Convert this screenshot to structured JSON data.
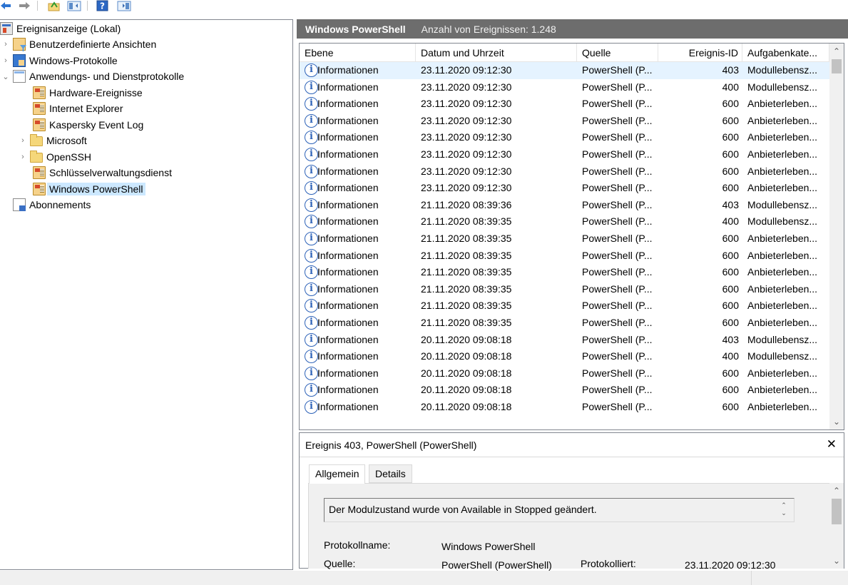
{
  "toolbar": {
    "buttons": [
      "back-icon",
      "forward-icon",
      "up-folder-icon",
      "show-hide-console-tree-icon",
      "help-icon",
      "show-hide-action-pane-icon"
    ]
  },
  "tree": {
    "items": [
      {
        "label": "Ereignisanzeige (Lokal)",
        "icon": "event-viewer-icon",
        "expanded": true
      },
      {
        "label": "Benutzerdefinierte Ansichten",
        "icon": "custom-views-icon"
      },
      {
        "label": "Windows-Protokolle",
        "icon": "windows-logs-icon"
      },
      {
        "label": "Anwendungs- und Dienstprotokolle",
        "icon": "app-service-logs-icon",
        "expanded": true
      },
      {
        "label": "Hardware-Ereignisse",
        "icon": "log-icon"
      },
      {
        "label": "Internet Explorer",
        "icon": "log-icon"
      },
      {
        "label": "Kaspersky Event Log",
        "icon": "log-icon"
      },
      {
        "label": "Microsoft",
        "icon": "folder-icon"
      },
      {
        "label": "OpenSSH",
        "icon": "folder-icon"
      },
      {
        "label": "Schlüsselverwaltungsdienst",
        "icon": "log-icon"
      },
      {
        "label": "Windows PowerShell",
        "icon": "log-icon",
        "selected": true
      },
      {
        "label": "Abonnements",
        "icon": "subscriptions-icon"
      }
    ]
  },
  "log": {
    "name": "Windows PowerShell",
    "count_text": "Anzahl von Ereignissen: 1.248"
  },
  "grid": {
    "columns": [
      "Ebene",
      "Datum und Uhrzeit",
      "Quelle",
      "Ereignis-ID",
      "Aufgabenkate..."
    ],
    "rows": [
      [
        "Informationen",
        "23.11.2020 09:12:30",
        "PowerShell (P...",
        "403",
        "Modullebensz..."
      ],
      [
        "Informationen",
        "23.11.2020 09:12:30",
        "PowerShell (P...",
        "400",
        "Modullebensz..."
      ],
      [
        "Informationen",
        "23.11.2020 09:12:30",
        "PowerShell (P...",
        "600",
        "Anbieterleben..."
      ],
      [
        "Informationen",
        "23.11.2020 09:12:30",
        "PowerShell (P...",
        "600",
        "Anbieterleben..."
      ],
      [
        "Informationen",
        "23.11.2020 09:12:30",
        "PowerShell (P...",
        "600",
        "Anbieterleben..."
      ],
      [
        "Informationen",
        "23.11.2020 09:12:30",
        "PowerShell (P...",
        "600",
        "Anbieterleben..."
      ],
      [
        "Informationen",
        "23.11.2020 09:12:30",
        "PowerShell (P...",
        "600",
        "Anbieterleben..."
      ],
      [
        "Informationen",
        "23.11.2020 09:12:30",
        "PowerShell (P...",
        "600",
        "Anbieterleben..."
      ],
      [
        "Informationen",
        "21.11.2020 08:39:36",
        "PowerShell (P...",
        "403",
        "Modullebensz..."
      ],
      [
        "Informationen",
        "21.11.2020 08:39:35",
        "PowerShell (P...",
        "400",
        "Modullebensz..."
      ],
      [
        "Informationen",
        "21.11.2020 08:39:35",
        "PowerShell (P...",
        "600",
        "Anbieterleben..."
      ],
      [
        "Informationen",
        "21.11.2020 08:39:35",
        "PowerShell (P...",
        "600",
        "Anbieterleben..."
      ],
      [
        "Informationen",
        "21.11.2020 08:39:35",
        "PowerShell (P...",
        "600",
        "Anbieterleben..."
      ],
      [
        "Informationen",
        "21.11.2020 08:39:35",
        "PowerShell (P...",
        "600",
        "Anbieterleben..."
      ],
      [
        "Informationen",
        "21.11.2020 08:39:35",
        "PowerShell (P...",
        "600",
        "Anbieterleben..."
      ],
      [
        "Informationen",
        "21.11.2020 08:39:35",
        "PowerShell (P...",
        "600",
        "Anbieterleben..."
      ],
      [
        "Informationen",
        "20.11.2020 09:08:18",
        "PowerShell (P...",
        "403",
        "Modullebensz..."
      ],
      [
        "Informationen",
        "20.11.2020 09:08:18",
        "PowerShell (P...",
        "400",
        "Modullebensz..."
      ],
      [
        "Informationen",
        "20.11.2020 09:08:18",
        "PowerShell (P...",
        "600",
        "Anbieterleben..."
      ],
      [
        "Informationen",
        "20.11.2020 09:08:18",
        "PowerShell (P...",
        "600",
        "Anbieterleben..."
      ],
      [
        "Informationen",
        "20.11.2020 09:08:18",
        "PowerShell (P...",
        "600",
        "Anbieterleben..."
      ]
    ]
  },
  "details": {
    "title": "Ereignis 403, PowerShell (PowerShell)",
    "tabs": [
      "Allgemein",
      "Details"
    ],
    "description": "Der Modulzustand wurde von Available in Stopped geändert.",
    "fields": {
      "log_name_label": "Protokollname:",
      "log_name_value": "Windows PowerShell",
      "source_label": "Quelle:",
      "source_value": "PowerShell (PowerShell)",
      "logged_label": "Protokolliert:",
      "logged_value": "23.11.2020 09:12:30"
    }
  },
  "colors": {
    "header_bg": "#6d6d6d",
    "selected_row": "#e5f3ff",
    "selected_tree": "#cce8ff",
    "info_icon": "#2d62b8"
  }
}
